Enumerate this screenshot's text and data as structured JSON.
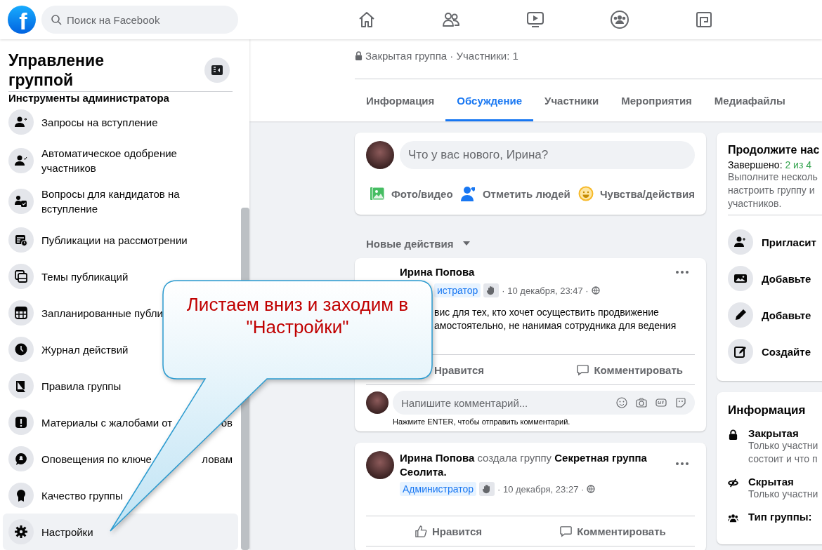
{
  "header": {
    "logo_letter": "f",
    "search": {
      "placeholder": "Поиск на Facebook"
    }
  },
  "sidebar": {
    "title": "Управление группой",
    "section": "Инструменты администратора",
    "items": [
      {
        "label": "Запросы на вступление",
        "selected": false
      },
      {
        "label": "Автоматическое одобрение участников",
        "selected": false
      },
      {
        "label": "Вопросы для кандидатов на вступление",
        "selected": false
      },
      {
        "label": "Публикации на рассмотрении",
        "selected": false
      },
      {
        "label": "Темы публикаций",
        "selected": false
      },
      {
        "label": "Запланированные публи",
        "selected": false
      },
      {
        "label": "Журнал действий",
        "selected": false
      },
      {
        "label": "Правила группы",
        "selected": false
      },
      {
        "label": "Материалы с жалобами от",
        "label_end": "ов",
        "selected": false
      },
      {
        "label": "Оповещения по ключе",
        "label_end": "ловам",
        "selected": false
      },
      {
        "label": "Качество группы",
        "selected": false
      },
      {
        "label": "Настройки",
        "selected": true
      }
    ]
  },
  "group": {
    "privacy": "Закрытая группа · Участники: 1"
  },
  "tabs": [
    {
      "label": "Информация",
      "selected": false
    },
    {
      "label": "Обсуждение",
      "selected": true
    },
    {
      "label": "Участники",
      "selected": false
    },
    {
      "label": "Мероприятия",
      "selected": false
    },
    {
      "label": "Медиафайлы",
      "selected": false
    }
  ],
  "composer": {
    "placeholder": "Что у вас нового, Ирина?",
    "actions": [
      "Фото/видео",
      "Отметить людей",
      "Чувства/действия"
    ]
  },
  "feed_sort": "Новые действия",
  "posts": [
    {
      "kind": "status",
      "author": "Ирина Попова",
      "role": "истратор",
      "time": "· 10 декабря, 23:47 ·",
      "body": [
        "вис для тех, кто хочет осуществить продвижение",
        "амостоятельно, не нанимая сотрудника для ведения"
      ],
      "like": "Нравится",
      "comment": "Комментировать",
      "comment_field": {
        "placeholder": "Напишите комментарий..."
      },
      "hint": "Нажмите ENTER, чтобы отправить комментарий."
    },
    {
      "kind": "group_created",
      "headline": "**Ирина Попова** создала группу **Секретная группа Сеолита.**",
      "role": "Администратор",
      "time": "· 10 декабря, 23:27 ·",
      "like": "Нравится",
      "comment": "Комментировать"
    }
  ],
  "setup": {
    "title": "Продолжите нас",
    "progress_label": "Завершено:",
    "progress_value": "2 из 4",
    "lines": [
      "Выполните несколь",
      "настроить группу и",
      "участников."
    ],
    "items": [
      "Пригласит",
      "Добавьте",
      "Добавьте",
      "Создайте"
    ]
  },
  "about": {
    "title": "Информация",
    "items": [
      {
        "title": "Закрытая",
        "lines": [
          "Только участни",
          "состоит и что п"
        ]
      },
      {
        "title": "Скрытая",
        "lines": [
          "Только участни"
        ]
      },
      {
        "title": "Тип группы:"
      }
    ]
  },
  "callout": {
    "text": "Листаем вниз и заходим в \"Настройки\""
  }
}
